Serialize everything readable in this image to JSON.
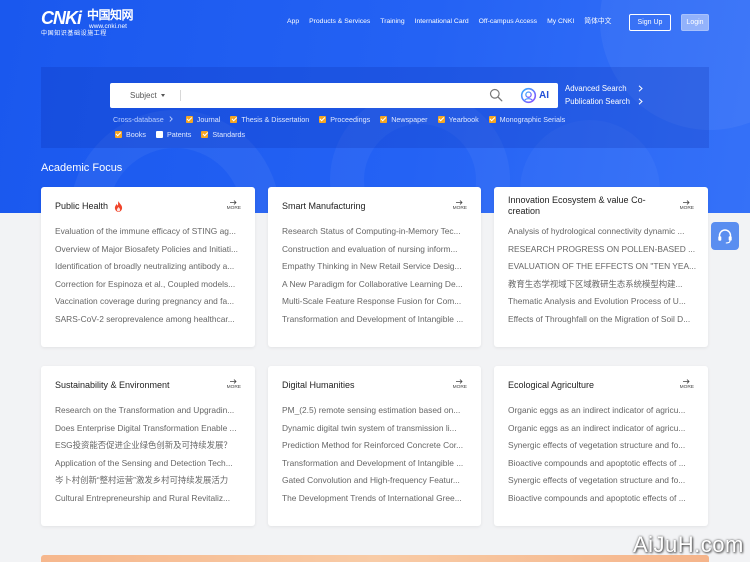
{
  "logo": {
    "brand": "CNKi",
    "brand_cn": "中国知网",
    "url": "www.cnki.net",
    "tagline": "中国知识基础设施工程"
  },
  "nav": {
    "items": [
      "App",
      "Products & Services",
      "Training",
      "International Card",
      "Off-campus Access",
      "My CNKI",
      "简体中文"
    ],
    "signup": "Sign Up",
    "login": "Login"
  },
  "search": {
    "field": "Subject",
    "ai_label": "AI",
    "advanced": "Advanced Search",
    "publication": "Publication Search",
    "cross_database": "Cross-database",
    "databases": [
      {
        "label": "Journal",
        "checked": true
      },
      {
        "label": "Thesis & Dissertation",
        "checked": true
      },
      {
        "label": "Proceedings",
        "checked": true
      },
      {
        "label": "Newspaper",
        "checked": true
      },
      {
        "label": "Yearbook",
        "checked": true
      },
      {
        "label": "Monographic Serials",
        "checked": true
      },
      {
        "label": "Books",
        "checked": true
      },
      {
        "label": "Patents",
        "checked": false
      },
      {
        "label": "Standards",
        "checked": true
      }
    ]
  },
  "focus": {
    "heading": "Academic Focus",
    "more": "MORE",
    "cards": [
      {
        "title": "Public Health",
        "icon": "flame-icon",
        "items": [
          "Evaluation of the immune efficacy of STING ag...",
          "Overview of Major Biosafety Policies and Initiati...",
          "Identification of broadly neutralizing antibody a...",
          "Correction for Espinoza et al., Coupled models...",
          "Vaccination coverage during pregnancy and fa...",
          "SARS-CoV-2 seroprevalence among healthcar..."
        ]
      },
      {
        "title": "Smart Manufacturing",
        "items": [
          "Research Status of Computing-in-Memory Tec...",
          "Construction and evaluation of nursing inform...",
          "Empathy Thinking in New Retail Service Desig...",
          "A New Paradigm for Collaborative Learning De...",
          "Multi-Scale Feature Response Fusion for Com...",
          "Transformation and Development of Intangible ..."
        ]
      },
      {
        "title": "Innovation Ecosystem & value Co-creation",
        "items": [
          "Analysis of hydrological connectivity dynamic ...",
          "RESEARCH PROGRESS ON POLLEN-BASED ...",
          "EVALUATION OF THE EFFECTS ON \"TEN YEA...",
          "教育生态学视域下区域教研生态系统模型构建...",
          "Thematic Analysis and Evolution Process of U...",
          "Effects of Throughfall on the Migration of Soil D..."
        ]
      },
      {
        "title": "Sustainability & Environment",
        "items": [
          "Research on the Transformation and Upgradin...",
          "Does Enterprise Digital Transformation Enable ...",
          "ESG投资能否促进企业绿色创新及可持续发展？",
          "Application of the Sensing and Detection Tech...",
          "岑卜村创新“整村运营”激发乡村可持续发展活力",
          "Cultural Entrepreneurship and Rural Revitaliz..."
        ]
      },
      {
        "title": "Digital Humanities",
        "items": [
          "PM_(2.5) remote sensing estimation based on...",
          "Dynamic digital twin system of transmission li...",
          "Prediction Method for Reinforced Concrete Cor...",
          "Transformation and Development of Intangible ...",
          "Gated Convolution and High-frequency Featur...",
          "The Development Trends of International Gree..."
        ]
      },
      {
        "title": "Ecological Agriculture",
        "items": [
          "Organic eggs as an indirect indicator of agricu...",
          "Organic eggs as an indirect indicator of agricu...",
          "Synergic effects of vegetation structure and fo...",
          "Bioactive compounds and apoptotic effects of ...",
          "Synergic effects of vegetation structure and fo...",
          "Bioactive compounds and apoptotic effects of ..."
        ]
      }
    ]
  },
  "side": {
    "icon": "headset-icon"
  },
  "watermark": "AiJuH.com",
  "colors": {
    "hero_blue": "#2462f4",
    "checkbox_checked": "#f5a623",
    "item_text": "#666666",
    "title_text": "#222222",
    "footer_strip": "#f6b78d"
  }
}
